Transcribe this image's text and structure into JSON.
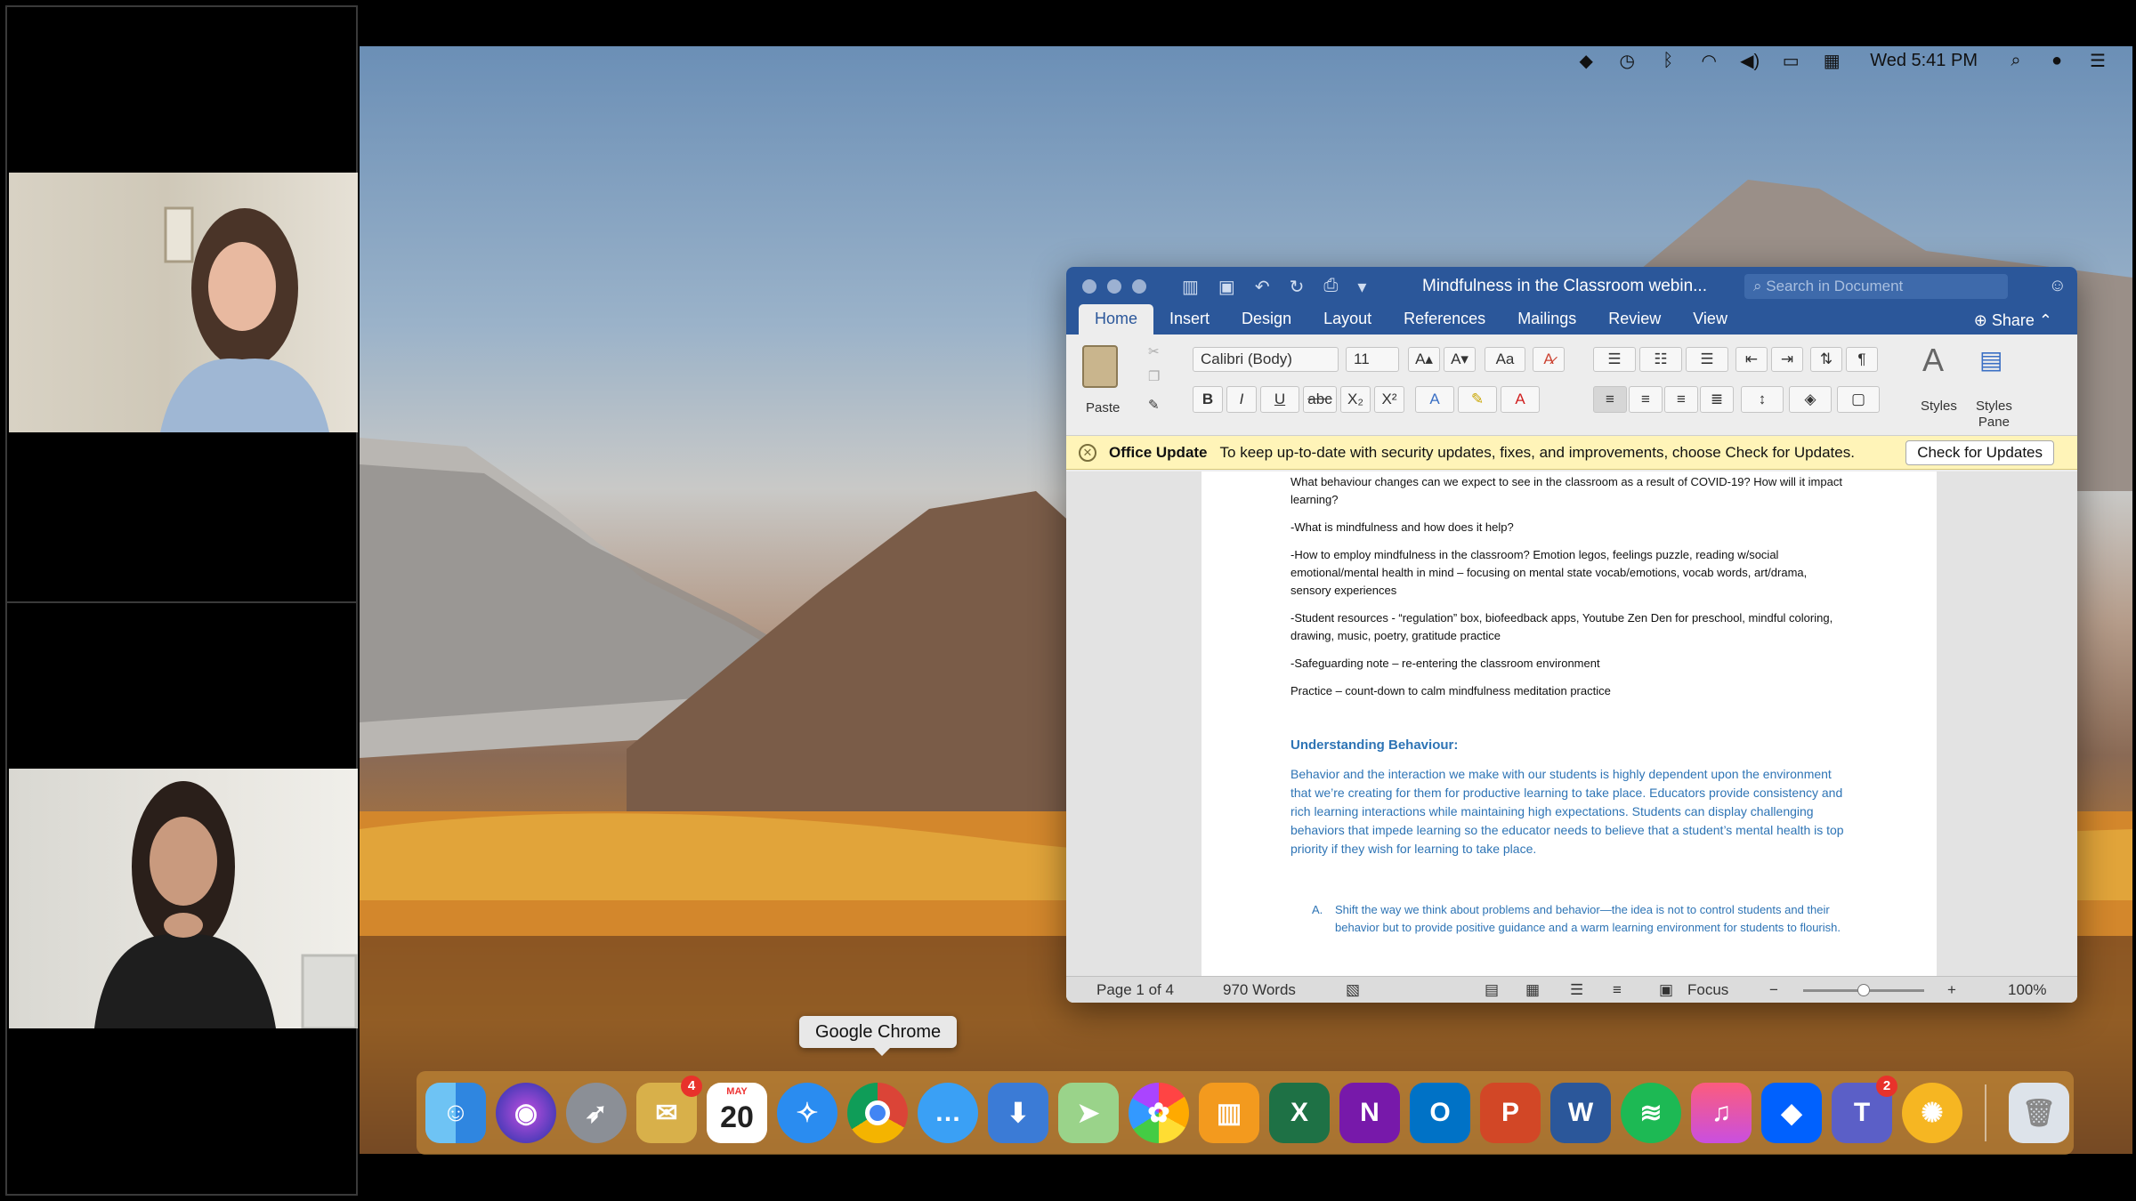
{
  "menubar": {
    "icons": [
      "dropbox-icon",
      "time-machine-icon",
      "bluetooth-icon",
      "wifi-icon",
      "volume-icon",
      "battery-icon",
      "flag-icon"
    ],
    "clock": "Wed 5:41 PM"
  },
  "word": {
    "title": "Mindfulness in the Classroom webin...",
    "search_placeholder": "Search in Document",
    "tabs": [
      "Home",
      "Insert",
      "Design",
      "Layout",
      "References",
      "Mailings",
      "Review",
      "View"
    ],
    "share_label": "Share",
    "ribbon": {
      "paste_label": "Paste",
      "font_name": "Calibri (Body)",
      "font_size": "11",
      "styles_label": "Styles",
      "styles_pane_label": "Styles\nPane"
    },
    "notice": {
      "title": "Office Update",
      "message": "To keep up-to-date with security updates, fixes, and improvements, choose Check for Updates.",
      "button": "Check for Updates"
    },
    "document": {
      "p1": "What behaviour changes can we expect to see in the classroom as a result of COVID-19? How will it impact learning?",
      "p2": "-What is mindfulness and how does it help?",
      "p3": "-How to employ mindfulness in the classroom? Emotion legos, feelings puzzle, reading w/social emotional/mental health in mind – focusing on mental state vocab/emotions, vocab words, art/drama, sensory experiences",
      "p4": "-Student resources - “regulation” box, biofeedback apps, Youtube Zen Den for preschool, mindful coloring, drawing, music, poetry, gratitude practice",
      "p5": "-Safeguarding note – re-entering the classroom environment",
      "p6": "Practice – count-down to calm mindfulness meditation practice",
      "heading": "Understanding Behaviour:",
      "body": "Behavior and the interaction we make with our students is highly dependent upon the environment that we’re creating for them for productive learning to take place. Educators provide consistency and rich learning interactions while maintaining high expectations. Students can display challenging behaviors that impede learning so the educator needs to believe that a student’s mental health is top priority if they wish for learning to take place.",
      "list_marker": "A.",
      "list_item": "Shift the way we think about problems and behavior—the idea is not to control students and their behavior but to provide positive guidance and a warm learning environment for students to flourish."
    },
    "status": {
      "page": "Page 1 of 4",
      "words": "970 Words",
      "focus": "Focus",
      "zoom": "100%",
      "zoom_fraction": 0.5
    }
  },
  "tooltip": "Google Chrome",
  "dock": {
    "calendar_month": "MAY",
    "calendar_day": "20",
    "mail_badge": "4",
    "teams_badge": "2",
    "excel": "X",
    "onenote": "N",
    "outlook": "O",
    "powerpoint": "P",
    "word": "W",
    "teams": "T"
  }
}
